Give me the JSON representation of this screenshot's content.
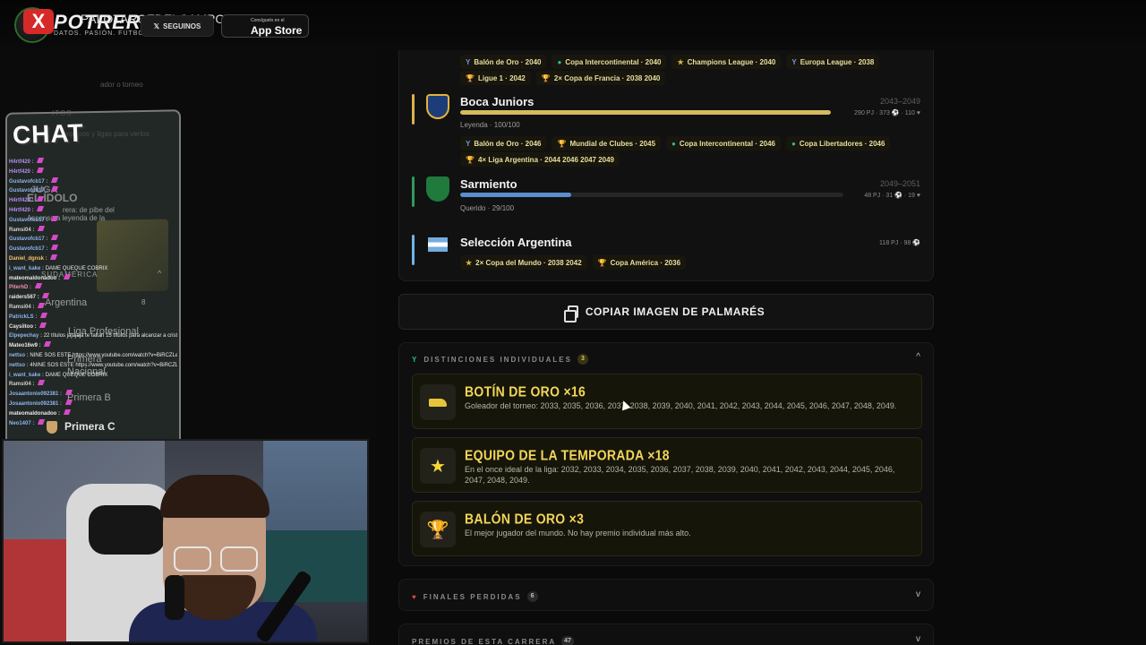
{
  "overlay": {
    "brand": "POTRERO",
    "handle": "PALOTAROFDELCAMPO",
    "tagline": "DATOS. PASIÓN. FÚTBOL.",
    "follow_label": "SEGUINOS",
    "store_small": "Consíguelo en el",
    "store_big": "App Store"
  },
  "sidebar": {
    "faint_search": "ador o torneo",
    "faint_favorites": "ITOS",
    "faint_hint": "equipos y ligas para verlos",
    "idol_title": "EL ÍDOLO",
    "idol_jugada": "JUGA",
    "idol_desc1": "rera: de pibe del",
    "idol_desc2": "Ascenso a leyenda de la",
    "region": "SUDAMÉRICA",
    "country": "Argentina",
    "country_count": "8",
    "league": "Liga Profesional",
    "primera_nacional": "Primera Nacional",
    "primera_b": "Primera B",
    "primera_c": "Primera C"
  },
  "chat": {
    "title": "CHAT",
    "messages": [
      {
        "user": "H4rtf420 :",
        "text": "",
        "color": "#b58cf0"
      },
      {
        "user": "H4rtf420 :",
        "text": "",
        "color": "#b58cf0"
      },
      {
        "user": "Gustavofcb17 :",
        "text": "",
        "color": "#8fb4f0"
      },
      {
        "user": "Gustavofcb17 :",
        "text": "",
        "color": "#8fb4f0"
      },
      {
        "user": "H4rtf420 :",
        "text": "",
        "color": "#b58cf0"
      },
      {
        "user": "H4rtf420 :",
        "text": "",
        "color": "#b58cf0"
      },
      {
        "user": "Gustavofcb17 :",
        "text": "",
        "color": "#8fb4f0"
      },
      {
        "user": "Ramsi04 :",
        "text": "",
        "color": "#d0d0d0"
      },
      {
        "user": "Gustavofcb17 :",
        "text": "",
        "color": "#8fb4f0"
      },
      {
        "user": "Gustavofcb17 :",
        "text": "",
        "color": "#8fb4f0"
      },
      {
        "user": "Daniel_dgnsk :",
        "text": "",
        "color": "#f0c070"
      },
      {
        "user": "i_want_kake :",
        "text": "DAME QUEQUE COBRIX",
        "color": "#8fb4f0"
      },
      {
        "user": "mateomaldonadoo :",
        "text": "",
        "color": "#e8e8e8"
      },
      {
        "user": "PiterhD :",
        "text": "",
        "color": "#f08fb4"
      },
      {
        "user": "raiders567 :",
        "text": "",
        "color": "#e8e8e8"
      },
      {
        "user": "Ramsi04 :",
        "text": "",
        "color": "#d0d0d0"
      },
      {
        "user": "PatrickLS :",
        "text": "",
        "color": "#8fb4f0"
      },
      {
        "user": "Caysiitoo :",
        "text": "",
        "color": "#e8e8e8"
      },
      {
        "user": "Elpepechay :",
        "text": "22 títulos jajajaja te faltan 15 títulos para alcanzar a cristiano",
        "color": "#8fb4f0"
      },
      {
        "user": "Mateo16w9 :",
        "text": "",
        "color": "#e8e8e8"
      },
      {
        "user": "nettso :",
        "text": "NINE SOS ESTE https://www.youtube.com/watch?v=BiRCZLelrvQ",
        "color": "#8fb4f0"
      },
      {
        "user": "nettso :",
        "text": "4NINE SOS ESTE https://www.youtube.com/watch?v=BiRCZLelrvQ",
        "color": "#8fb4f0"
      },
      {
        "user": "i_want_kake :",
        "text": "DAME QUEQUE COBRIX",
        "color": "#8fb4f0"
      },
      {
        "user": "Ramsi04 :",
        "text": "",
        "color": "#d0d0d0"
      },
      {
        "user": "Josaantonio092381 :",
        "text": "",
        "color": "#8fb4f0"
      },
      {
        "user": "Josaantonio092381 :",
        "text": "",
        "color": "#8fb4f0"
      },
      {
        "user": "mateomaldonadoo :",
        "text": "",
        "color": "#e8e8e8"
      },
      {
        "user": "Neo1407 :",
        "text": "",
        "color": "#8fb4f0"
      }
    ]
  },
  "career": {
    "top_chips_row1": [
      {
        "icon": "trophy-icon",
        "label": "Balón de Oro · 2040"
      },
      {
        "icon": "globe-icon",
        "label": "Copa Intercontinental · 2040"
      },
      {
        "icon": "star-icon",
        "label": "Champions League · 2040"
      },
      {
        "icon": "trophy-icon",
        "label": "Europa League · 2038"
      }
    ],
    "top_chips_row2": [
      {
        "icon": "cup-icon",
        "label": "Ligue 1 · 2042"
      },
      {
        "icon": "cup-icon",
        "label": "2× Copa de Francia · 2038 2040"
      }
    ],
    "teams": [
      {
        "name": "Boca Juniors",
        "years": "2043–2049",
        "stats": "290 PJ · 373 ⚽ · 110 ♥",
        "level": "Leyenda · 100/100",
        "progress": 1.0,
        "accent": "#d8b34a",
        "chips_row1": [
          "Balón de Oro · 2046",
          "Mundial de Clubes · 2045",
          "Copa Intercontinental · 2046",
          "Copa Libertadores · 2046"
        ],
        "chips_row2": [
          "4× Liga Argentina · 2044 2046 2047 2049"
        ]
      },
      {
        "name": "Sarmiento",
        "years": "2049–2051",
        "stats": "48 PJ · 31 ⚽ · 19 ♥",
        "level": "Querido · 29/100",
        "progress": 0.29,
        "accent": "#2e9a5c"
      },
      {
        "name": "Selección Argentina",
        "years": "",
        "stats": "118 PJ · 98 ⚽",
        "chips_row1": [
          "2× Copa del Mundo · 2038 2042",
          "Copa América · 2036"
        ],
        "accent": "#6fb4e8"
      }
    ]
  },
  "copy_button": "COPIAR IMAGEN DE PALMARÉS",
  "distinctions": {
    "header": "DISTINCIONES INDIVIDUALES",
    "count": "3",
    "items": [
      {
        "title": "BOTÍN DE ORO ×16",
        "desc": "Goleador del torneo: 2033, 2035, 2036, 2037, 2038, 2039, 2040, 2041, 2042, 2043, 2044, 2045, 2046, 2047, 2048, 2049.",
        "icon": "boot-icon"
      },
      {
        "title": "EQUIPO DE LA TEMPORADA ×18",
        "desc": "En el once ideal de la liga: 2032, 2033, 2034, 2035, 2036, 2037, 2038, 2039, 2040, 2041, 2042, 2043, 2044, 2045, 2046, 2047, 2048, 2049.",
        "icon": "star-icon"
      },
      {
        "title": "BALÓN DE ORO ×3",
        "desc": "El mejor jugador del mundo. No hay premio individual más alto.",
        "icon": "trophy-icon"
      }
    ]
  },
  "lost_finals": {
    "header": "FINALES PERDIDAS",
    "count": "6"
  },
  "career_awards": {
    "header": "PREMIOS DE ESTA CARRERA",
    "count": "47"
  }
}
